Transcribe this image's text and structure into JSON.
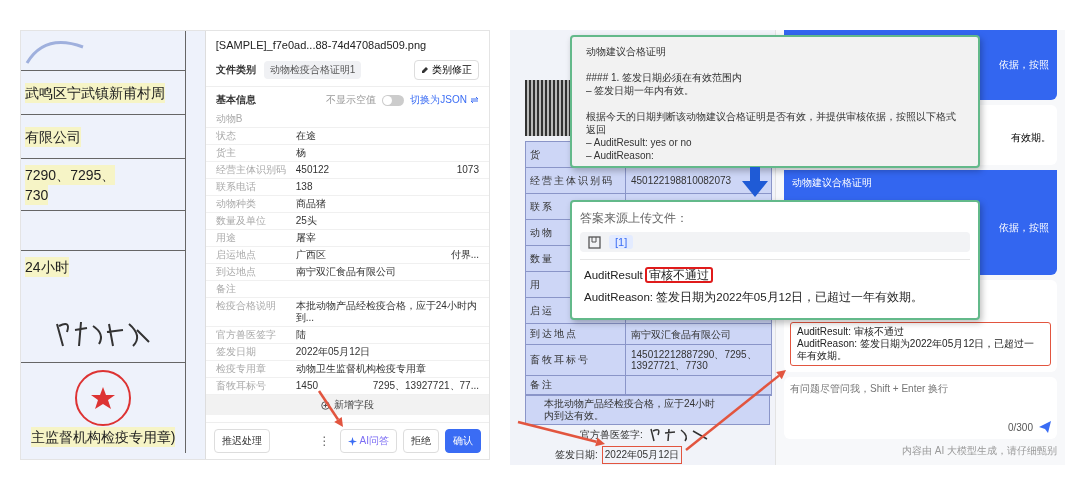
{
  "left_screenshot": {
    "document": {
      "rows": [
        {
          "kind": "emblem"
        },
        {
          "kind": "text",
          "lines": [
            "武鸣区宁武镇新甫村周"
          ]
        },
        {
          "kind": "text",
          "lines": [
            "有限公司"
          ]
        },
        {
          "kind": "text",
          "lines": [
            "7290、7295、",
            "730"
          ]
        },
        {
          "kind": "blank"
        },
        {
          "kind": "note",
          "lines": [
            "24小时"
          ]
        },
        {
          "kind": "signature"
        },
        {
          "kind": "stamp",
          "lines": [
            "主监督机构检疫专用章)"
          ]
        }
      ]
    },
    "form": {
      "file_name": "[SAMPLE]_f7e0ad...88-74d4708ad509.png",
      "category_label": "文件类别",
      "category_value": "动物检疫合格证明1",
      "category_fix_button": "类别修正",
      "section_title": "基本信息",
      "hide_empty_label": "不显示空值",
      "hide_empty_on": false,
      "json_switch": "切换为JSON",
      "fields": [
        {
          "label": "动物B"
        },
        {
          "label": "状态",
          "value": "在途"
        },
        {
          "label": "货主",
          "value": "杨"
        },
        {
          "label": "经营主体识别码",
          "value": "450122",
          "value_2": "1073"
        },
        {
          "label": "联系电话",
          "value": "138"
        },
        {
          "label": "动物种类",
          "value": "商品猪"
        },
        {
          "label": "数量及单位",
          "value": "25头"
        },
        {
          "label": "用途",
          "value": "屠宰"
        },
        {
          "label": "启运地点",
          "value": "广西区",
          "value_2": "付界..."
        },
        {
          "label": "到达地点",
          "value": "南宁双汇食品有限公司"
        },
        {
          "label": "备注"
        },
        {
          "label": "检疫合格说明",
          "value": "本批动物产品经检疫合格，应于24小时内到..."
        },
        {
          "label": "官方兽医签字",
          "value": "陆"
        },
        {
          "label": "签发日期",
          "value": "2022年05月12日"
        },
        {
          "label": "检疫专用章",
          "value": "动物卫生监督机构检疫专用章"
        },
        {
          "label": "畜牧耳标号",
          "value": "1450",
          "value_2": "7295、13927721、77..."
        }
      ],
      "add_field": "新增字段",
      "footer": {
        "defer_button": "推迟处理",
        "more_icon": "⋮",
        "ai_button": "AI问答",
        "reject_button": "拒绝",
        "confirm_button": "确认"
      }
    }
  },
  "right_screenshot": {
    "document": {
      "rows": [
        {
          "label": "货"
        },
        {
          "label": "经营主体识别码",
          "value": "450122198810082073"
        },
        {
          "label": "联系"
        },
        {
          "label": "动物"
        },
        {
          "label": "数量"
        },
        {
          "label": "用"
        },
        {
          "label": "启运"
        },
        {
          "label": "到达地点",
          "value": "南宁双汇食品有限公司"
        },
        {
          "label": "畜牧耳标号",
          "value": "145012212887290、7295、13927721、7730"
        },
        {
          "label": "备注"
        }
      ],
      "note": "本批动物产品经检疫合格，应于24小时内到达有效。",
      "vet_label": "官方兽医签字:",
      "date_label": "签发日期:",
      "date_value": "2022年05月12日",
      "date_highlighted": true
    },
    "prompt_callout": {
      "paragraphs": [
        {
          "lines": [
            "动物建议合格证明"
          ]
        },
        {
          "lines": [
            "#### 1. 签发日期必须在有效范围内",
            "– 签发日期一年内有效。"
          ]
        },
        {
          "lines": [
            "根据今天的日期判断该动物建议合格证明是否有效，并提供审核依据，按照以下格式返回",
            "– AuditResult: yes or no",
            "– AuditReason:"
          ]
        }
      ]
    },
    "answer_callout": {
      "source_label": "答案来源上传文件：",
      "citation": "[1]",
      "result_label": "AuditResult",
      "result_value": "审核不通过",
      "result_highlighted": true,
      "reason": "AuditReason: 签发日期为2022年05月12日，已超过一年有效期。"
    },
    "chat": {
      "messages": [
        {
          "kind": "user",
          "text": "依据，按照"
        },
        {
          "kind": "answer",
          "text": "有效期。"
        },
        {
          "kind": "user",
          "title": "动物建议合格证明",
          "text": "依据，按照"
        },
        {
          "kind": "answer",
          "result_lines": [
            "AuditResult: 审核不通过",
            "AuditReason: 签发日期为2022年05月12日，已超过一年有效期。"
          ],
          "highlighted": true
        }
      ],
      "input": {
        "placeholder": "有问题尽管问我，Shift + Enter 换行",
        "counter": "0/300"
      },
      "disclaimer": "内容由 AI 大模型生成，请仔细甄别"
    }
  }
}
